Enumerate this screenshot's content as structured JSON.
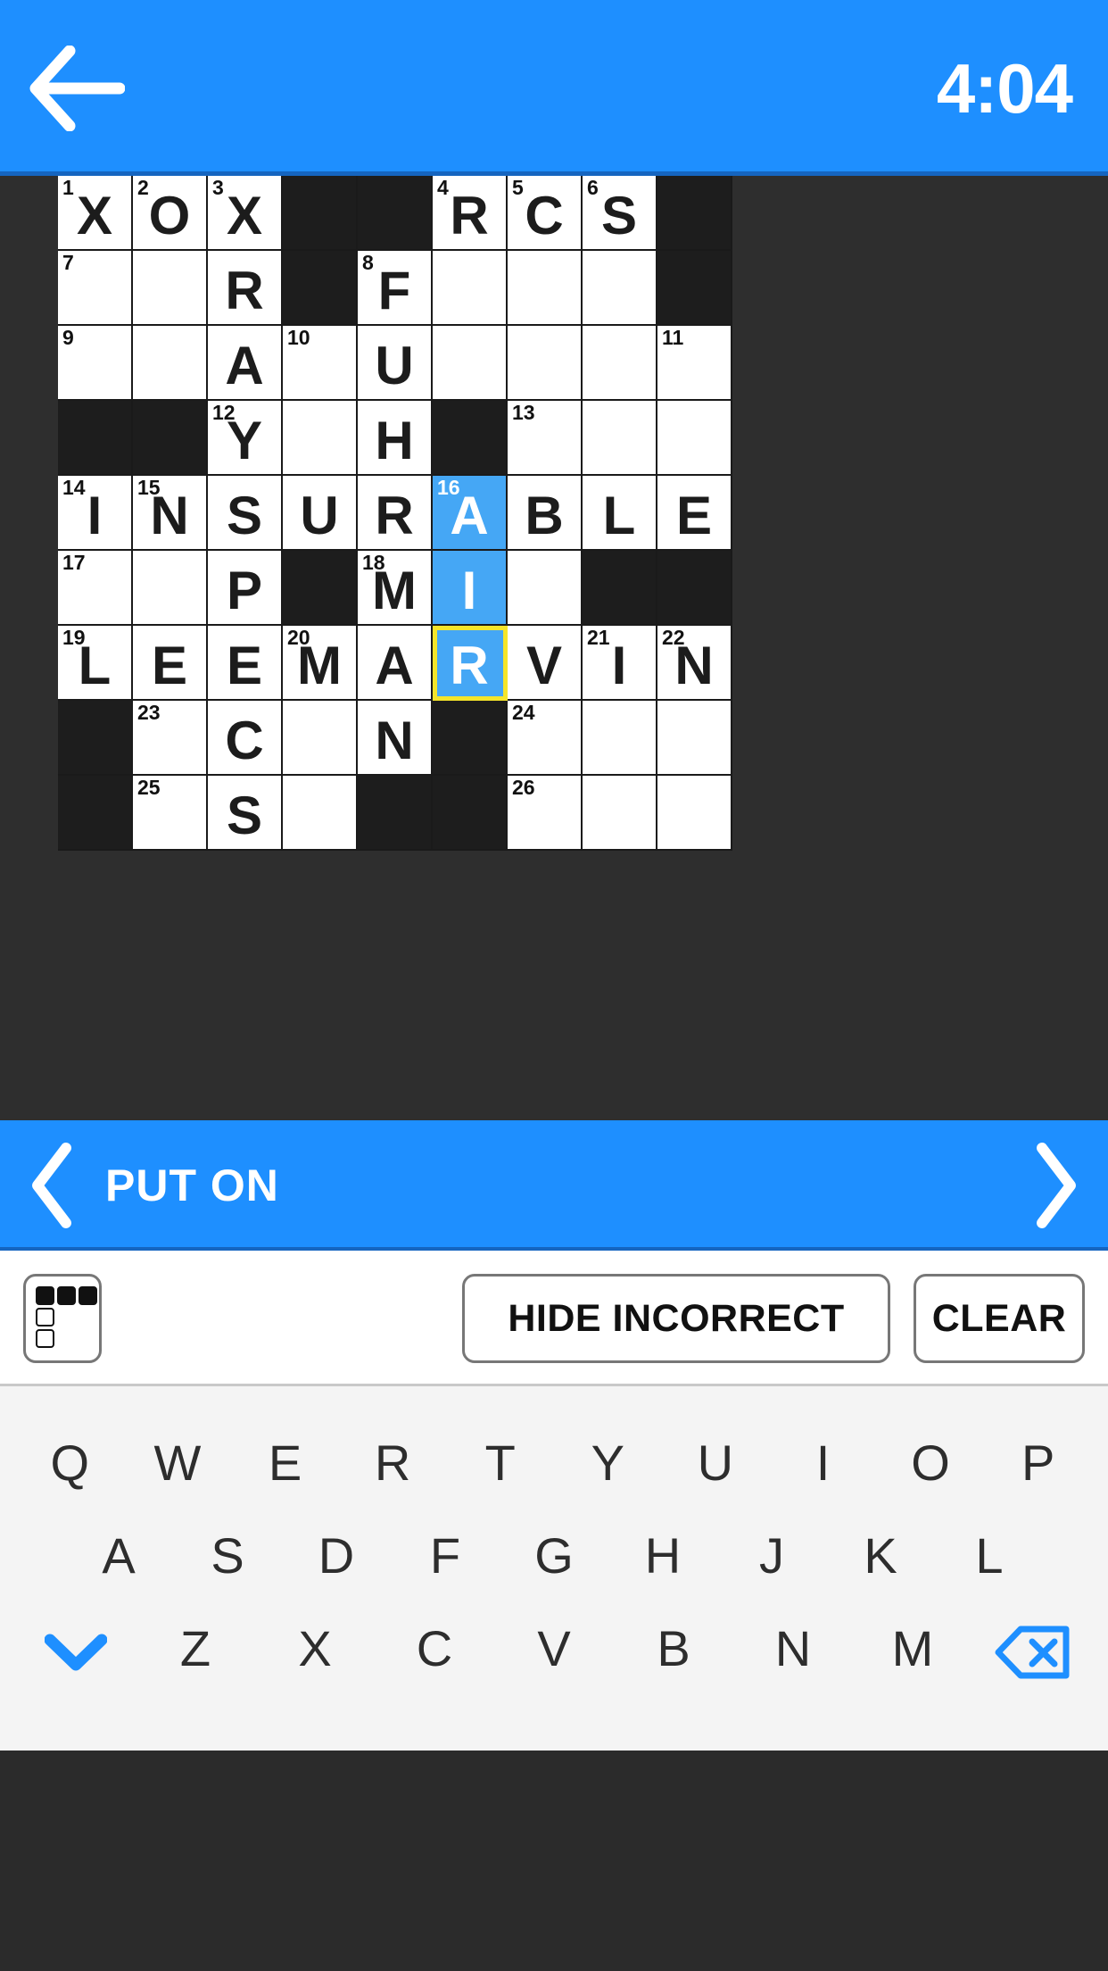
{
  "appbar": {
    "back_icon": "back-arrow-icon",
    "timer": "4:04"
  },
  "clue_bar": {
    "prev_icon": "chevron-left-icon",
    "next_icon": "chevron-right-icon",
    "clue": "PUT ON"
  },
  "toolbar": {
    "grid_toggle_icon": "puzzle-layout-icon",
    "hide_incorrect_label": "HIDE INCORRECT",
    "clear_label": "CLEAR"
  },
  "keyboard": {
    "row1": [
      "Q",
      "W",
      "E",
      "R",
      "T",
      "Y",
      "U",
      "I",
      "O",
      "P"
    ],
    "row2": [
      "A",
      "S",
      "D",
      "F",
      "G",
      "H",
      "J",
      "K",
      "L"
    ],
    "row3": [
      "Z",
      "X",
      "C",
      "V",
      "B",
      "N",
      "M"
    ],
    "hide_keyboard_icon": "chevron-down-icon",
    "backspace_icon": "backspace-icon"
  },
  "colors": {
    "accent": "#1e8fff",
    "highlight": "#45a7f5",
    "selection_border": "#f5e52a",
    "block": "#1d1d1d",
    "page_bg": "#2b2b2b"
  },
  "grid": {
    "columns": 9,
    "rows": 9,
    "cells": [
      [
        {
          "t": "o",
          "n": "1",
          "l": "X"
        },
        {
          "t": "o",
          "n": "2",
          "l": "O"
        },
        {
          "t": "o",
          "n": "3",
          "l": "X"
        },
        {
          "t": "b"
        },
        {
          "t": "b"
        },
        {
          "t": "o",
          "n": "4",
          "l": "R"
        },
        {
          "t": "o",
          "n": "5",
          "l": "C"
        },
        {
          "t": "o",
          "n": "6",
          "l": "S"
        },
        {
          "t": "b"
        }
      ],
      [
        {
          "t": "o",
          "n": "7",
          "l": ""
        },
        {
          "t": "o",
          "l": ""
        },
        {
          "t": "o",
          "l": "R"
        },
        {
          "t": "b"
        },
        {
          "t": "o",
          "n": "8",
          "l": "F"
        },
        {
          "t": "o",
          "l": ""
        },
        {
          "t": "o",
          "l": ""
        },
        {
          "t": "o",
          "l": ""
        },
        {
          "t": "b"
        }
      ],
      [
        {
          "t": "o",
          "n": "9",
          "l": ""
        },
        {
          "t": "o",
          "l": ""
        },
        {
          "t": "o",
          "l": "A"
        },
        {
          "t": "o",
          "n": "10",
          "l": ""
        },
        {
          "t": "o",
          "l": "U"
        },
        {
          "t": "o",
          "l": ""
        },
        {
          "t": "o",
          "l": ""
        },
        {
          "t": "o",
          "l": ""
        },
        {
          "t": "o",
          "n": "11",
          "l": ""
        }
      ],
      [
        {
          "t": "b"
        },
        {
          "t": "b"
        },
        {
          "t": "o",
          "n": "12",
          "l": "Y"
        },
        {
          "t": "o",
          "l": ""
        },
        {
          "t": "o",
          "l": "H"
        },
        {
          "t": "b"
        },
        {
          "t": "o",
          "n": "13",
          "l": ""
        },
        {
          "t": "o",
          "l": ""
        },
        {
          "t": "o",
          "l": ""
        }
      ],
      [
        {
          "t": "o",
          "n": "14",
          "l": "I"
        },
        {
          "t": "o",
          "n": "15",
          "l": "N"
        },
        {
          "t": "o",
          "l": "S"
        },
        {
          "t": "o",
          "l": "U"
        },
        {
          "t": "o",
          "l": "R"
        },
        {
          "t": "h",
          "n": "16",
          "l": "A"
        },
        {
          "t": "o",
          "l": "B"
        },
        {
          "t": "o",
          "l": "L"
        },
        {
          "t": "o",
          "l": "E"
        }
      ],
      [
        {
          "t": "o",
          "n": "17",
          "l": ""
        },
        {
          "t": "o",
          "l": ""
        },
        {
          "t": "o",
          "l": "P"
        },
        {
          "t": "b"
        },
        {
          "t": "o",
          "n": "18",
          "l": "M"
        },
        {
          "t": "h",
          "l": "I"
        },
        {
          "t": "o",
          "l": ""
        },
        {
          "t": "b"
        },
        {
          "t": "b"
        }
      ],
      [
        {
          "t": "o",
          "n": "19",
          "l": "L"
        },
        {
          "t": "o",
          "l": "E"
        },
        {
          "t": "o",
          "l": "E"
        },
        {
          "t": "o",
          "n": "20",
          "l": "M"
        },
        {
          "t": "o",
          "l": "A"
        },
        {
          "t": "s",
          "l": "R"
        },
        {
          "t": "o",
          "l": "V"
        },
        {
          "t": "o",
          "n": "21",
          "l": "I"
        },
        {
          "t": "o",
          "n": "22",
          "l": "N"
        }
      ],
      [
        {
          "t": "b"
        },
        {
          "t": "o",
          "n": "23",
          "l": ""
        },
        {
          "t": "o",
          "l": "C"
        },
        {
          "t": "o",
          "l": ""
        },
        {
          "t": "o",
          "l": "N"
        },
        {
          "t": "b"
        },
        {
          "t": "o",
          "n": "24",
          "l": ""
        },
        {
          "t": "o",
          "l": ""
        },
        {
          "t": "o",
          "l": ""
        }
      ],
      [
        {
          "t": "b"
        },
        {
          "t": "o",
          "n": "25",
          "l": ""
        },
        {
          "t": "o",
          "l": "S"
        },
        {
          "t": "o",
          "l": ""
        },
        {
          "t": "b"
        },
        {
          "t": "b"
        },
        {
          "t": "o",
          "n": "26",
          "l": ""
        },
        {
          "t": "o",
          "l": ""
        },
        {
          "t": "o",
          "l": ""
        }
      ]
    ]
  }
}
